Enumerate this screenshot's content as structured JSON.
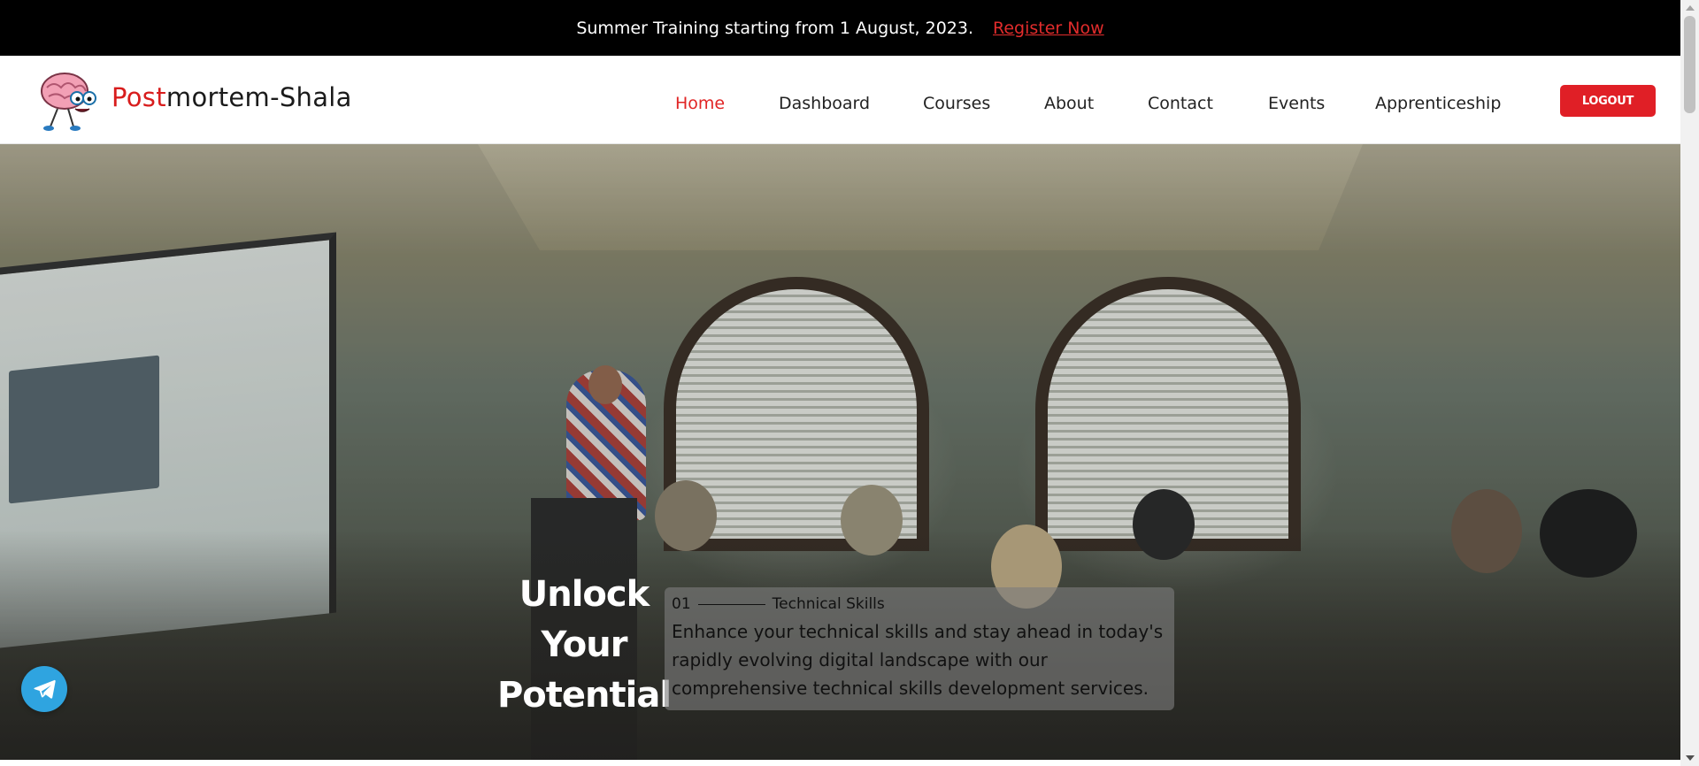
{
  "announcement": {
    "message": "Summer Training starting from 1 August, 2023.",
    "link_label": "Register Now"
  },
  "brand": {
    "name_red": "Post",
    "name_rest": "mortem-Shala",
    "logo_icon": "brain-mascot-icon"
  },
  "nav": {
    "items": [
      {
        "label": "Home",
        "active": true
      },
      {
        "label": "Dashboard"
      },
      {
        "label": "Courses"
      },
      {
        "label": "About"
      },
      {
        "label": "Contact"
      },
      {
        "label": "Events"
      },
      {
        "label": "Apprenticeship"
      }
    ],
    "logout_label": "LOGOUT"
  },
  "hero": {
    "title_line1": "Unlock",
    "title_line2": "Your",
    "title_line3": "Potential",
    "card": {
      "number": "01",
      "tagline": "Technical Skills",
      "description": "Enhance your technical skills and stay ahead in today's rapidly evolving digital landscape with our comprehensive technical skills development services."
    },
    "background_image": "classroom-presentation-photo"
  },
  "floating": {
    "telegram_icon": "telegram-icon"
  },
  "colors": {
    "accent": "#e01f26",
    "announcement_bg": "#000000",
    "telegram": "#2fa4e0"
  }
}
